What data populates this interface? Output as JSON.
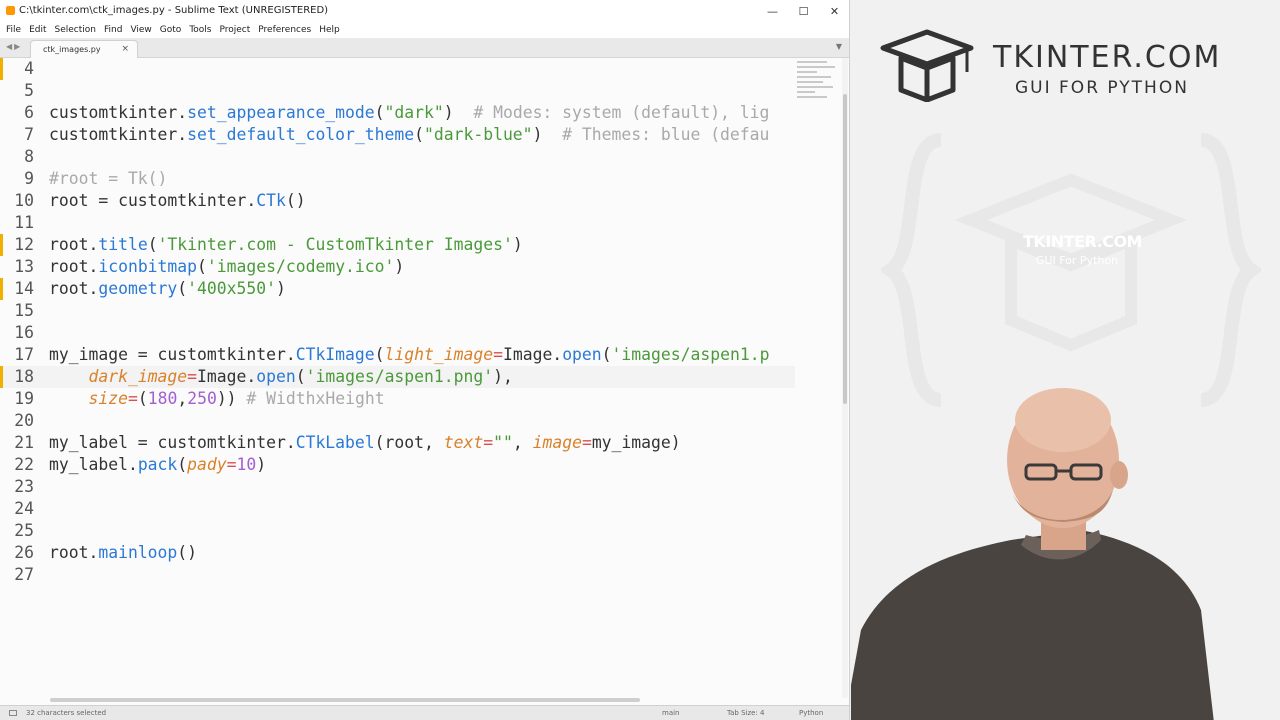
{
  "window": {
    "title": "C:\\tkinter.com\\ctk_images.py - Sublime Text (UNREGISTERED)",
    "buttons": {
      "minimize": "—",
      "maximize": "☐",
      "close": "✕"
    }
  },
  "menu": [
    "File",
    "Edit",
    "Selection",
    "Find",
    "View",
    "Goto",
    "Tools",
    "Project",
    "Preferences",
    "Help"
  ],
  "tab": {
    "name": "ctk_images.py",
    "close": "×"
  },
  "code_lines": {
    "l4": {
      "num": "4"
    },
    "l5": {
      "num": "5"
    },
    "l6": {
      "num": "6",
      "a": "customtkinter.",
      "b": "set_appearance_mode",
      "c": "(",
      "d": "\"dark\"",
      "e": ")  ",
      "f": "# Modes: system (default), lig"
    },
    "l7": {
      "num": "7",
      "a": "customtkinter.",
      "b": "set_default_color_theme",
      "c": "(",
      "d": "\"dark-blue\"",
      "e": ")  ",
      "f": "# Themes: blue (defau"
    },
    "l8": {
      "num": "8"
    },
    "l9": {
      "num": "9",
      "f": "#root = Tk()"
    },
    "l10": {
      "num": "10",
      "a": "root = customtkinter.",
      "b": "CTk",
      "c": "()"
    },
    "l11": {
      "num": "11"
    },
    "l12": {
      "num": "12",
      "a": "root.",
      "b": "title",
      "c": "(",
      "d": "'Tkinter.com - CustomTkinter Images'",
      "e": ")"
    },
    "l13": {
      "num": "13",
      "a": "root.",
      "b": "iconbitmap",
      "c": "(",
      "d": "'images/codemy.ico'",
      "e": ")"
    },
    "l14": {
      "num": "14",
      "a": "root.",
      "b": "geometry",
      "c": "(",
      "d": "'400x550'",
      "e": ")"
    },
    "l15": {
      "num": "15"
    },
    "l16": {
      "num": "16"
    },
    "l17": {
      "num": "17",
      "a": "my_image = customtkinter.",
      "b": "CTkImage",
      "c": "(",
      "k": "light_image",
      "eq": "=",
      "g": "Image.",
      "h": "open",
      "i": "(",
      "d": "'images/aspen1.p"
    },
    "l18": {
      "num": "18",
      "indent": "    ",
      "k": "dark_image",
      "eq": "=",
      "g": "Image.",
      "h": "open",
      "i": "(",
      "d": "'images/aspen1.png'",
      "e": "),"
    },
    "l19": {
      "num": "19",
      "indent": "    ",
      "k": "size",
      "eq": "=",
      "i": "(",
      "n1": "180",
      "cm": ",",
      "n2": "250",
      "e": ")) ",
      "f": "# WidthxHeight"
    },
    "l20": {
      "num": "20"
    },
    "l21": {
      "num": "21",
      "a": "my_label = customtkinter.",
      "b": "CTkLabel",
      "c": "(root, ",
      "k": "text",
      "eq": "=",
      "d": "\"\"",
      "m": ", ",
      "k2": "image",
      "eq2": "=",
      "e": "my_image)"
    },
    "l22": {
      "num": "22",
      "a": "my_label.",
      "b": "pack",
      "c": "(",
      "k": "pady",
      "eq": "=",
      "n1": "10",
      "e": ")"
    },
    "l23": {
      "num": "23"
    },
    "l24": {
      "num": "24"
    },
    "l25": {
      "num": "25"
    },
    "l26": {
      "num": "26",
      "a": "root.",
      "b": "mainloop",
      "c": "()"
    },
    "l27": {
      "num": "27"
    }
  },
  "status": {
    "selection": "32 characters selected",
    "branch": "main",
    "tab_size": "Tab Size: 4",
    "syntax": "Python"
  },
  "brand": {
    "title": "TKINTER.COM",
    "subtitle": "GUI FOR PYTHON",
    "shirt_line1": "TKINTER.COM",
    "shirt_line2": "GUI For Python"
  },
  "colors": {
    "function": "#2b79d5",
    "string": "#4a9a3a",
    "comment": "#a9a9a9",
    "keyword_arg": "#d9822b",
    "number": "#a35fcf",
    "operator": "#d94f4f",
    "modified_marker": "#f0b000"
  }
}
